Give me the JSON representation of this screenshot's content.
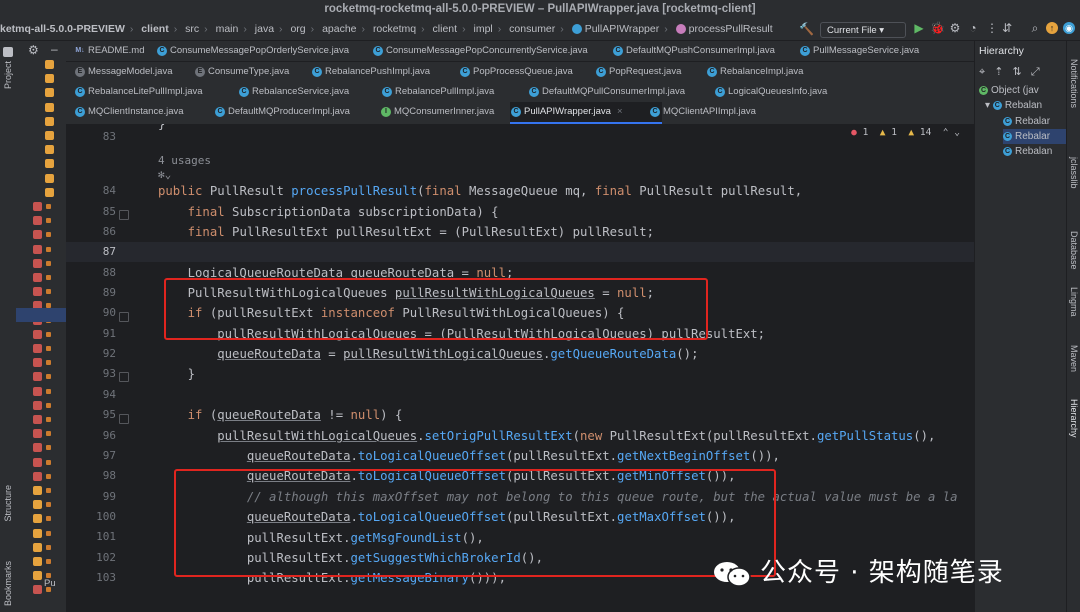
{
  "window": {
    "title": "rocketmq-rocketmq-all-5.0.0-PREVIEW – PullAPIWrapper.java [rocketmq-client]"
  },
  "breadcrumbs": [
    "ketmq-all-5.0.0-PREVIEW",
    "client",
    "src",
    "main",
    "java",
    "org",
    "apache",
    "rocketmq",
    "client",
    "impl",
    "consumer",
    "PullAPIWrapper",
    "processPullResult"
  ],
  "toolbar": {
    "run_config": "Current File ▾"
  },
  "tabs": {
    "row1": [
      {
        "label": "README.md",
        "icon": "md"
      },
      {
        "label": "ConsumeMessagePopOrderlyService.java",
        "icon": "c"
      },
      {
        "label": "ConsumeMessagePopConcurrentlyService.java",
        "icon": "c"
      },
      {
        "label": "DefaultMQPushConsumerImpl.java",
        "icon": "c"
      },
      {
        "label": "PullMessageService.java",
        "icon": "c"
      }
    ],
    "row2": [
      {
        "label": "MessageModel.java",
        "icon": "e"
      },
      {
        "label": "ConsumeType.java",
        "icon": "e"
      },
      {
        "label": "RebalancePushImpl.java",
        "icon": "c"
      },
      {
        "label": "PopProcessQueue.java",
        "icon": "c"
      },
      {
        "label": "PopRequest.java",
        "icon": "c"
      },
      {
        "label": "RebalanceImpl.java",
        "icon": "c"
      }
    ],
    "row3": [
      {
        "label": "RebalanceLitePullImpl.java",
        "icon": "c"
      },
      {
        "label": "RebalanceService.java",
        "icon": "c"
      },
      {
        "label": "RebalancePullImpl.java",
        "icon": "c"
      },
      {
        "label": "DefaultMQPullConsumerImpl.java",
        "icon": "c"
      },
      {
        "label": "LogicalQueuesInfo.java",
        "icon": "c"
      }
    ],
    "row4": [
      {
        "label": "MQClientInstance.java",
        "icon": "c"
      },
      {
        "label": "DefaultMQProducerImpl.java",
        "icon": "c"
      },
      {
        "label": "MQConsumerInner.java",
        "icon": "i"
      },
      {
        "label": "PullAPIWrapper.java",
        "icon": "c",
        "active": true
      },
      {
        "label": "MQClientAPIImpl.java",
        "icon": "c"
      }
    ]
  },
  "inspections": {
    "errors": "1",
    "warnings": "1",
    "weak": "14"
  },
  "editor": {
    "usages_hint": "4 usages",
    "line_numbers": [
      "83",
      "84",
      "85",
      "86",
      "87",
      "88",
      "89",
      "90",
      "91",
      "92",
      "93",
      "94",
      "95",
      "96",
      "97",
      "98",
      "99",
      "100",
      "101",
      "102",
      "103"
    ],
    "current_line": "87"
  },
  "hierarchy_panel": {
    "title": "Hierarchy",
    "root": "Object (jav",
    "items": [
      "Rebalan",
      "Rebalar",
      "Rebalar",
      "Rebalan"
    ]
  },
  "side_tools": {
    "left": [
      "Project",
      "Structure",
      "Bookmarks"
    ],
    "right": [
      "Notifications",
      "jclasslib",
      "Database",
      "Lingma",
      "Maven",
      "Hierarchy"
    ]
  },
  "watermark": "公众号 · 架构随笔录",
  "tree_bottom_label": "Pu"
}
